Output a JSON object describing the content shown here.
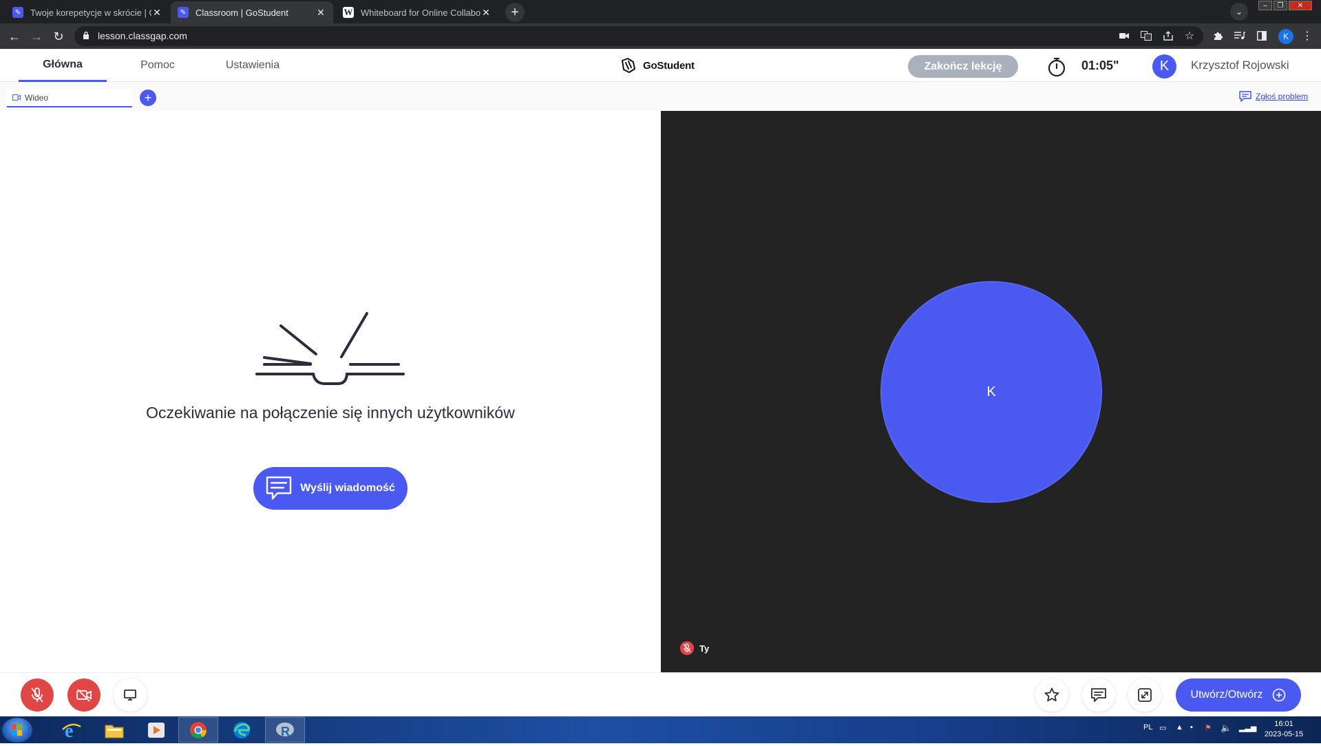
{
  "browser": {
    "tabs": [
      {
        "title": "Twoje korepetycje w skrócie | Go",
        "favicon": "gostudent-icon",
        "active": false
      },
      {
        "title": "Classroom | GoStudent",
        "favicon": "gostudent-icon",
        "active": true
      },
      {
        "title": "Whiteboard for Online Collabora",
        "favicon": "whiteboard-w-icon",
        "active": false
      }
    ],
    "url": "lesson.classgap.com",
    "profile_initial": "K"
  },
  "app": {
    "nav": [
      "Główna",
      "Pomoc",
      "Ustawienia"
    ],
    "brand": "GoStudent",
    "end_lesson": "Zakończ lekcję",
    "timer": "01:05\"",
    "user": {
      "initial": "K",
      "name": "Krzysztof Rojowski"
    },
    "sub_tab": "Wideo",
    "report_problem": "Zgłoś problem",
    "waiting_text": "Oczekiwanie na połączenie się innych użytkowników",
    "send_message": "Wyślij wiadomość",
    "video_avatar_initial": "K",
    "self_label": "Ty",
    "create_open": "Utwórz/Otwórz"
  },
  "taskbar": {
    "language": "PL",
    "time": "16:01",
    "date": "2023-05-15"
  },
  "colors": {
    "accent": "#4a5af0",
    "danger": "#e04646",
    "video_bg": "#232323"
  }
}
